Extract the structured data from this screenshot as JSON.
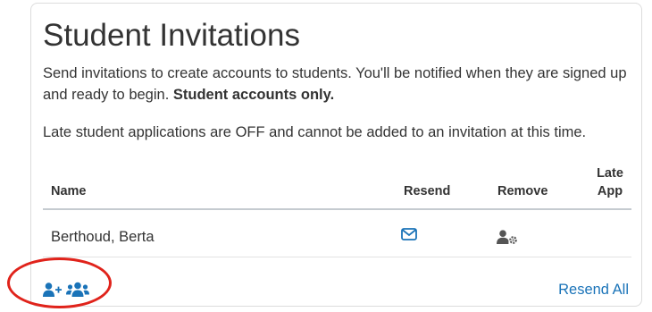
{
  "card": {
    "title": "Student Invitations",
    "description_main": "Send invitations to create accounts to students. You'll be notified when they are signed up and ready to begin. ",
    "description_bold": "Student accounts only.",
    "late_note": "Late student applications are OFF and cannot be added to an invitation at this time."
  },
  "table": {
    "headers": {
      "name": "Name",
      "resend": "Resend",
      "remove": "Remove",
      "late_line1": "Late",
      "late_line2": "App"
    },
    "rows": [
      {
        "name": "Berthoud, Berta"
      }
    ]
  },
  "footer": {
    "resend_all": "Resend All"
  },
  "icons": {
    "resend": "envelope-icon",
    "remove": "user-gear-icon",
    "add_user": "user-plus-icon",
    "add_group": "users-icon"
  },
  "colors": {
    "accent": "#1a73b8",
    "text": "#333333",
    "annotation": "#e0231b"
  }
}
